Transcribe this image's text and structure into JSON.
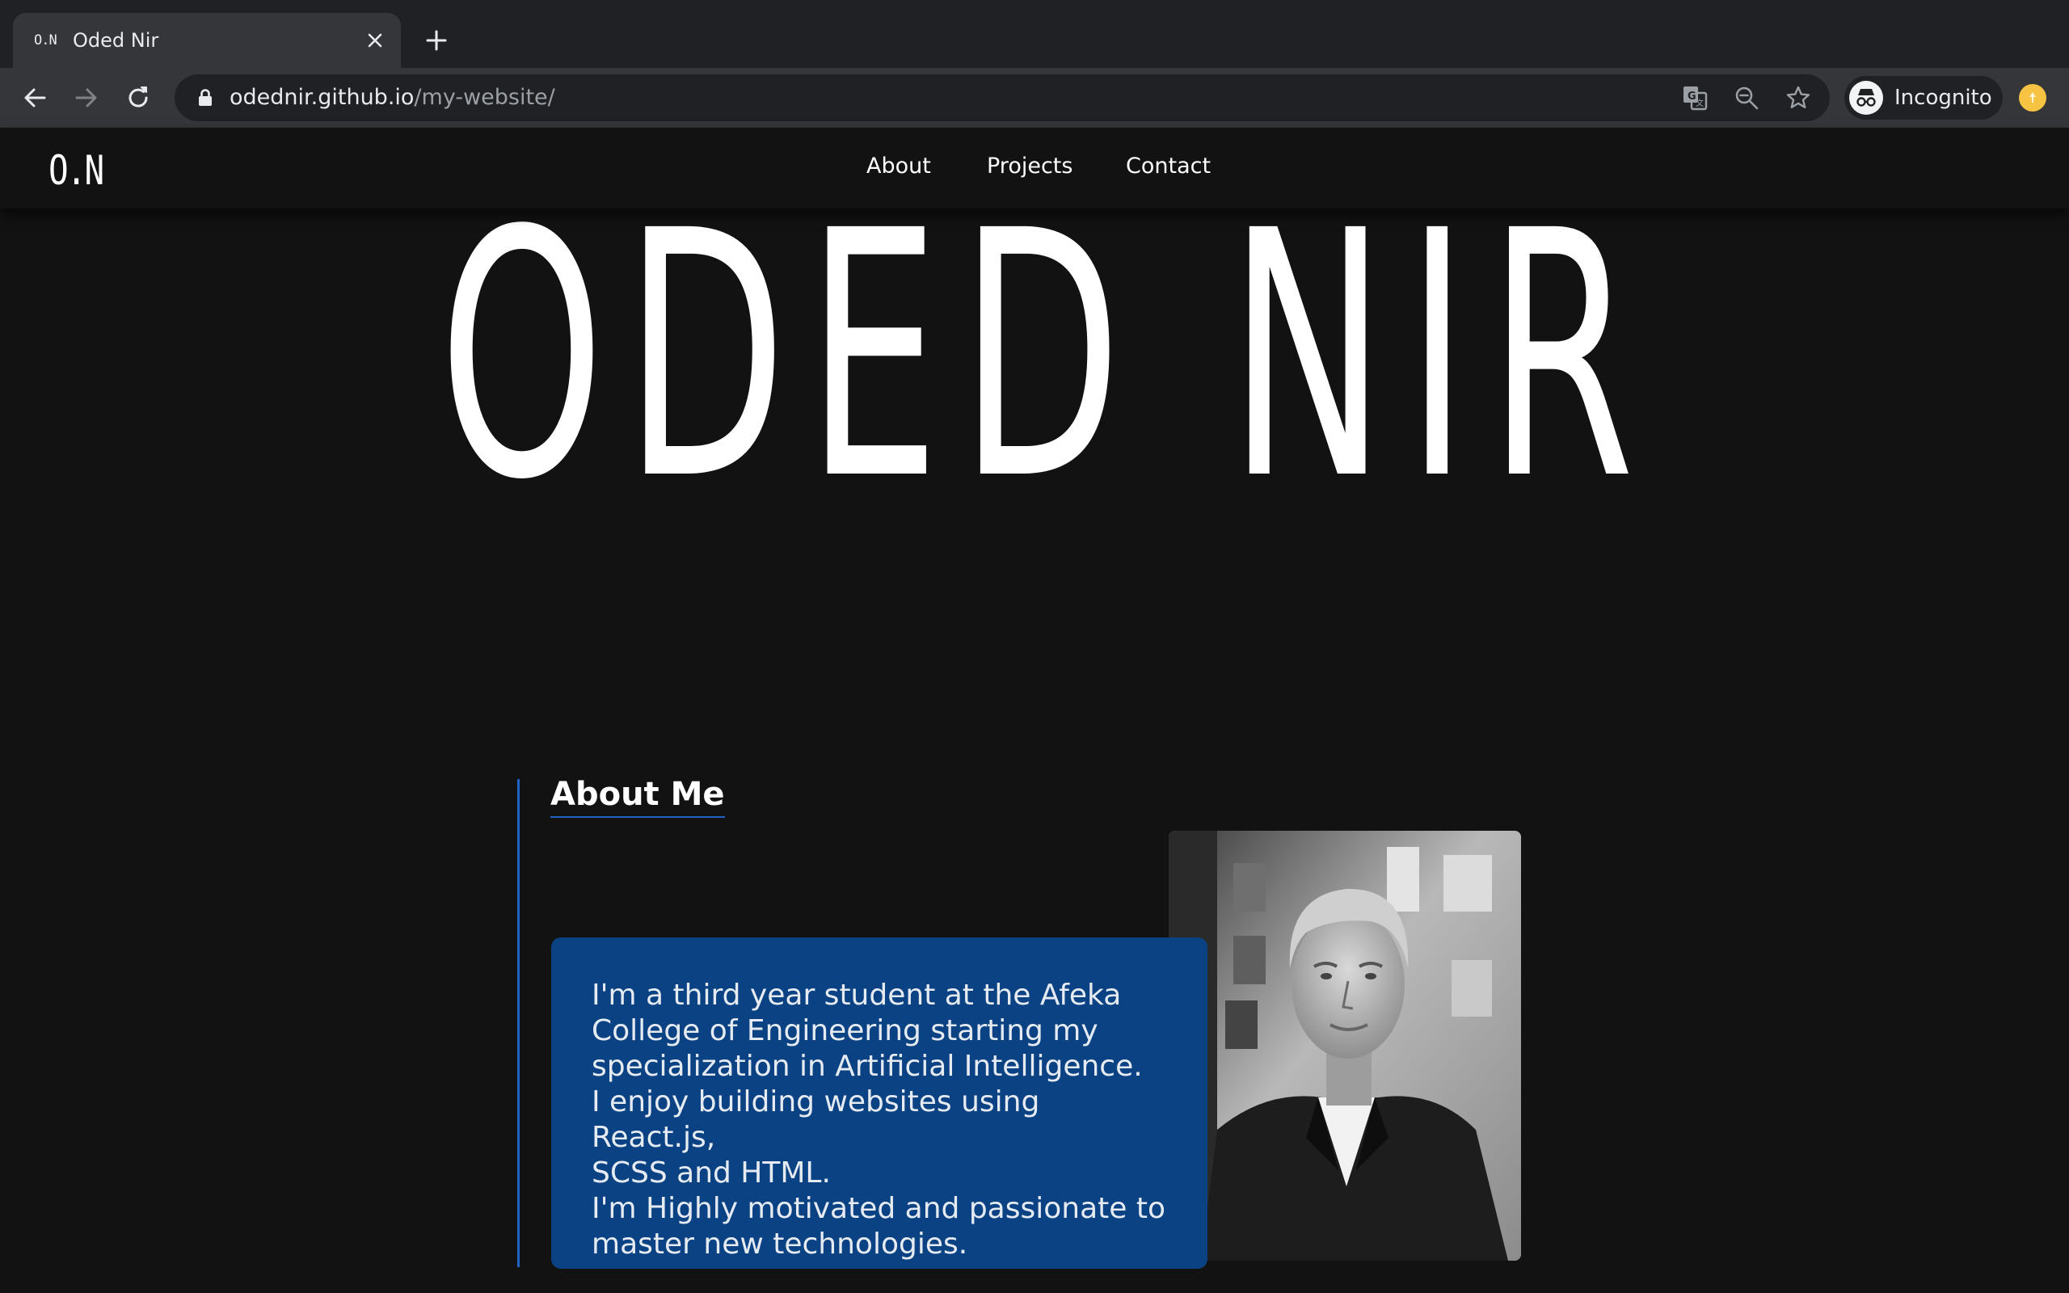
{
  "browser": {
    "tab": {
      "favicon_text": "O.N",
      "title": "Oded Nir",
      "close_icon": "close-icon"
    },
    "new_tab_icon": "plus-icon",
    "toolbar": {
      "back_icon": "arrow-left-icon",
      "forward_icon": "arrow-right-icon",
      "reload_icon": "reload-icon",
      "lock_icon": "lock-icon",
      "url_host": "odednir.github.io",
      "url_path": "/my-website/",
      "translate_icon": "translate-icon",
      "zoom_icon": "zoom-out-icon",
      "bookmark_icon": "star-icon",
      "profile_label": "Incognito",
      "extension_icon": "extension-icon"
    },
    "colors": {
      "tabstrip": "#202124",
      "toolbar": "#35363a",
      "omnibox": "#202124"
    }
  },
  "site": {
    "logo": "O.N",
    "nav": [
      "About",
      "Projects",
      "Contact"
    ],
    "hero_title": "ODED NIR",
    "about": {
      "heading": "About Me",
      "text": "I'm a third year student at the Afeka\nCollege of Engineering starting my\nspecialization in Artificial Intelligence.\nI enjoy building websites using React.js,\nSCSS and HTML.\nI'm Highly motivated and passionate to\nmaster new technologies.",
      "photo": "portrait-photo"
    },
    "colors": {
      "background": "#121212",
      "accent": "#1f62c1",
      "card": "#0a4283",
      "text": "#ffffff"
    }
  }
}
